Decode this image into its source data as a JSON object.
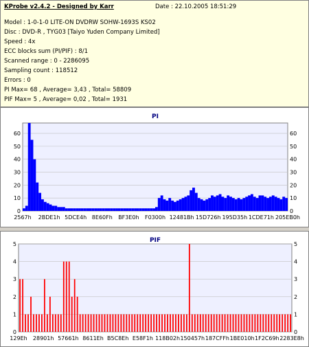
{
  "info": {
    "title": "KProbe v2.4.2 - Designed by Karr",
    "date": "Date : 22.10.2005 18:51:29",
    "lines": [
      "Model : 1-0-1-0 LITE-ON DVDRW SOHW-1693S KS02",
      "Disc : DVD-R , TYG03 [Taiyo Yuden Company Limited]",
      "Speed : 4x",
      "ECC blocks sum (PI/PIF) : 8/1",
      "Scanned range : 0 - 2286095",
      "Sampling count : 118512",
      "Errors : 0",
      "PI Max= 68 , Average= 3,43 , Total= 58809",
      "PIF Max= 5 , Average= 0,02 , Total= 1931"
    ]
  },
  "colors": {
    "pi": "#0000ff",
    "pif": "#ff0000",
    "plot_bg": "#eef0ff",
    "title": "#000080"
  },
  "chart_data": [
    {
      "type": "area",
      "title": "PI",
      "xlabel": "",
      "ylabel": "",
      "ylim": [
        0,
        68
      ],
      "yticks": [
        0,
        10,
        20,
        30,
        40,
        50,
        60
      ],
      "xticks": [
        "2567h",
        "2BDE1h",
        "5DCE4h",
        "8E60Fh",
        "BF3E0h",
        "F0300h",
        "12481Bh",
        "15D726h",
        "195D35h",
        "1CDE71h",
        "205EB0h"
      ],
      "grid": true,
      "series": [
        {
          "values": [
            2,
            4,
            68,
            55,
            40,
            22,
            14,
            9,
            7,
            6,
            5,
            4,
            4,
            3,
            3,
            3,
            2,
            2,
            2,
            2,
            2,
            2,
            2,
            2,
            2,
            2,
            2,
            2,
            2,
            2,
            2,
            2,
            2,
            2,
            2,
            2,
            2,
            2,
            2,
            2,
            2,
            2,
            2,
            2,
            2,
            2,
            2,
            2,
            2,
            2,
            3,
            10,
            12,
            9,
            8,
            10,
            8,
            7,
            8,
            9,
            10,
            11,
            12,
            16,
            18,
            14,
            10,
            9,
            8,
            9,
            10,
            12,
            11,
            12,
            13,
            11,
            10,
            12,
            11,
            10,
            9,
            10,
            9,
            10,
            11,
            12,
            13,
            11,
            10,
            12,
            12,
            11,
            10,
            11,
            12,
            11,
            10,
            9,
            11,
            10
          ]
        }
      ]
    },
    {
      "type": "bar",
      "title": "PIF",
      "xlabel": "",
      "ylabel": "",
      "ylim": [
        0,
        5
      ],
      "yticks": [
        0,
        1,
        2,
        3,
        4,
        5
      ],
      "xticks": [
        "129Eh",
        "28901h",
        "57661h",
        "8611Eh",
        "B5C8Eh",
        "E58F1h",
        "118B02h",
        "150457h",
        "187CFFh",
        "1BE010h",
        "1F2C69h",
        "2283E8h"
      ],
      "grid": true,
      "series": [
        {
          "values": [
            3,
            3,
            1,
            1,
            2,
            1,
            1,
            1,
            1,
            3,
            1,
            2,
            1,
            1,
            1,
            1,
            4,
            4,
            4,
            2,
            3,
            2,
            1,
            1,
            1,
            1,
            1,
            1,
            1,
            1,
            1,
            1,
            1,
            1,
            1,
            1,
            1,
            1,
            1,
            1,
            1,
            1,
            1,
            1,
            1,
            1,
            1,
            1,
            1,
            1,
            1,
            1,
            1,
            1,
            1,
            1,
            1,
            1,
            1,
            1,
            1,
            1,
            5,
            1,
            1,
            1,
            1,
            1,
            1,
            1,
            1,
            1,
            1,
            1,
            1,
            1,
            1,
            1,
            1,
            1,
            1,
            1,
            1,
            1,
            1,
            1,
            1,
            1,
            1,
            1,
            1,
            1,
            1,
            1,
            1,
            1,
            1,
            1,
            1,
            1
          ]
        }
      ]
    }
  ]
}
